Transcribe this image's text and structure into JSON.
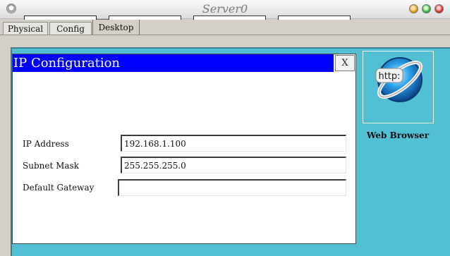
{
  "window": {
    "title": "Server0"
  },
  "tabs": [
    {
      "label": "Physical"
    },
    {
      "label": "Config"
    },
    {
      "label": "Desktop",
      "active": true
    }
  ],
  "desktop": {
    "apps": [
      {
        "label": "Web Browser",
        "icon": "web-browser-icon",
        "icon_text": "http:"
      }
    ]
  },
  "dialog": {
    "title": "IP Configuration",
    "close_label": "X",
    "fields": {
      "ip_address": {
        "label": "IP Address",
        "value": "192.168.1.100"
      },
      "subnet_mask": {
        "label": "Subnet Mask",
        "value": "255.255.255.0"
      },
      "default_gateway": {
        "label": "Default Gateway",
        "value": ""
      }
    }
  },
  "colors": {
    "desktop_background": "#53bfd3",
    "dialog_title_bar": "#0000ff"
  }
}
